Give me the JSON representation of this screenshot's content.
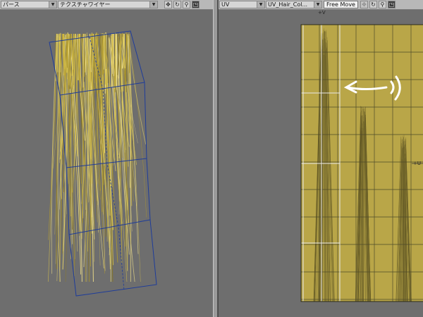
{
  "left_viewport": {
    "view_mode": "パース",
    "render_mode": "テクスチャワイヤー"
  },
  "right_viewport": {
    "view_mode": "UV",
    "uv_map": "UV_Hair_Col...",
    "tool_mode": "Free Move",
    "axis_u_label": "+U",
    "axis_v_label": "+V"
  },
  "icons": {
    "move": "move-icon",
    "rotate": "rotate-icon",
    "zoom": "zoom-icon",
    "maximize": "maximize-icon"
  },
  "colors": {
    "background": "#6e6e6e",
    "hair": "#d8c24a",
    "uv_fill": "#b9a648",
    "cage": "#1e3c9a"
  }
}
